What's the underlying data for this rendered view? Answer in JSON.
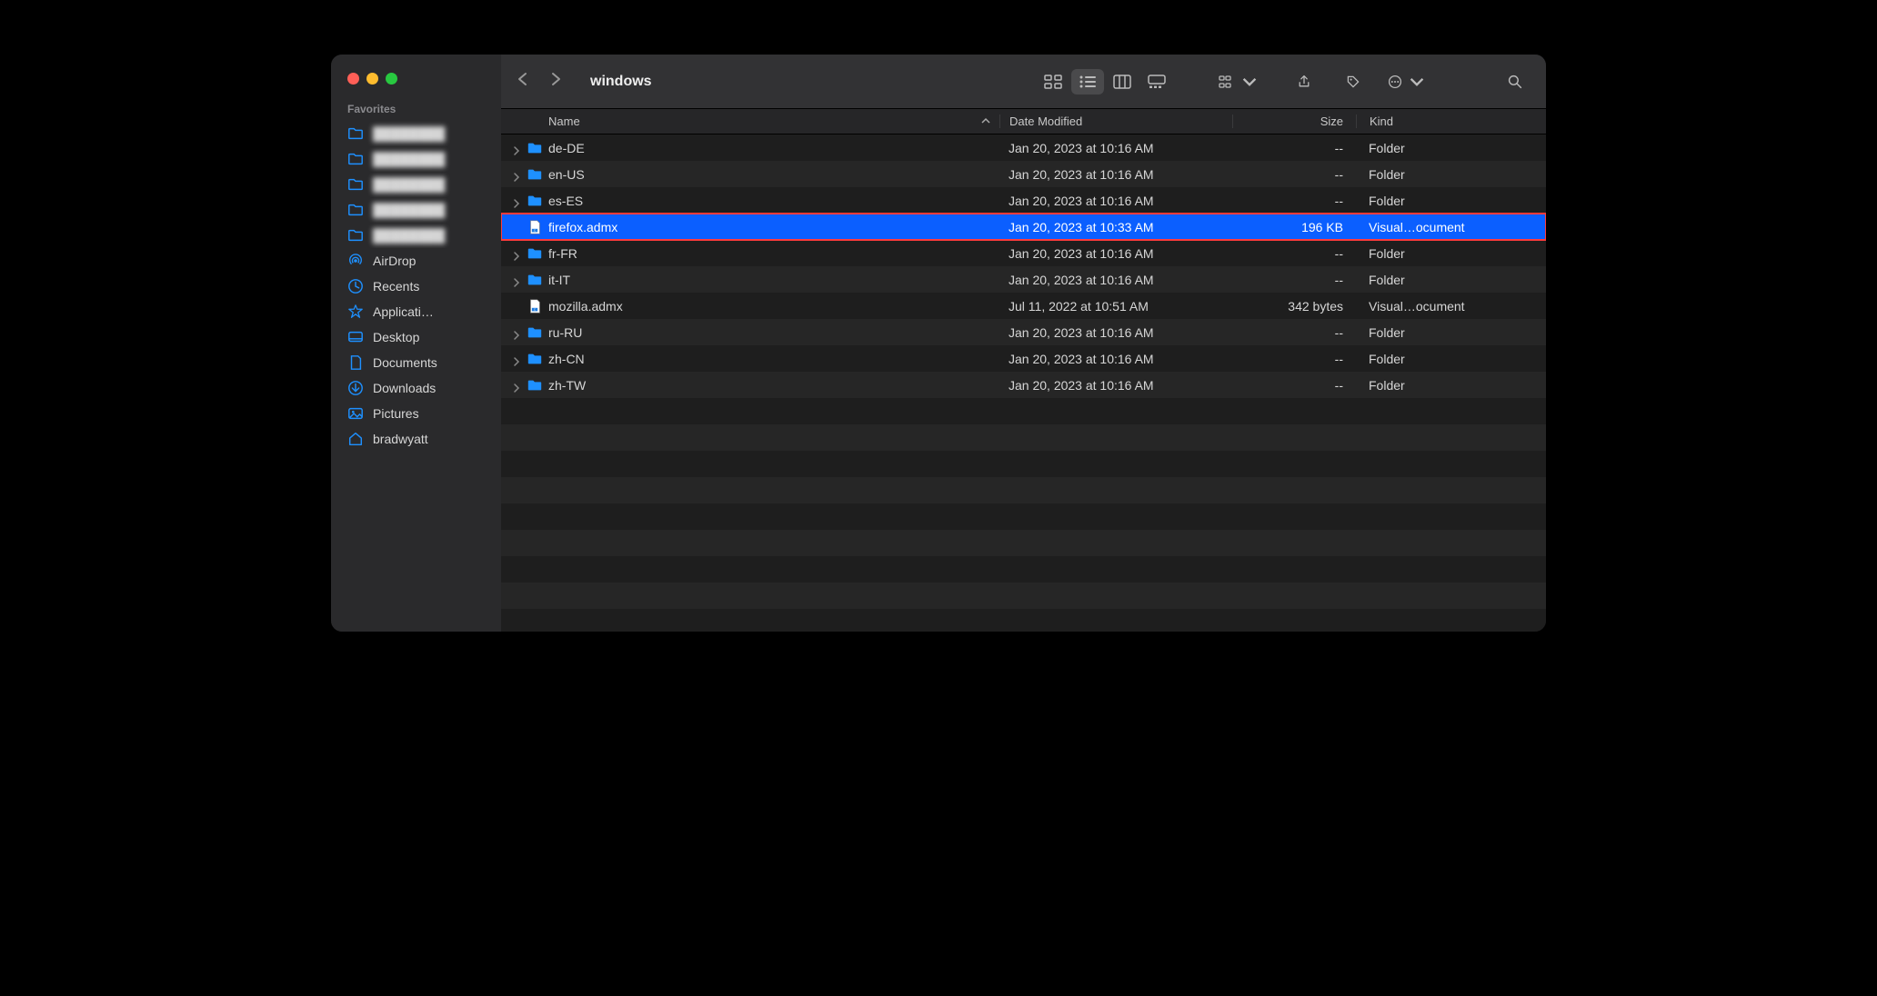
{
  "window": {
    "title": "windows"
  },
  "sidebar": {
    "header": "Favorites",
    "items": [
      {
        "icon": "folder",
        "label": "████████",
        "blurred": true
      },
      {
        "icon": "folder",
        "label": "████████",
        "blurred": true
      },
      {
        "icon": "folder",
        "label": "████████",
        "blurred": true
      },
      {
        "icon": "folder",
        "label": "████████",
        "blurred": true
      },
      {
        "icon": "folder",
        "label": "████████",
        "blurred": true
      },
      {
        "icon": "airdrop",
        "label": "AirDrop",
        "blurred": false
      },
      {
        "icon": "recents",
        "label": "Recents",
        "blurred": false
      },
      {
        "icon": "apps",
        "label": "Applicati…",
        "blurred": false
      },
      {
        "icon": "desktop",
        "label": "Desktop",
        "blurred": false
      },
      {
        "icon": "documents",
        "label": "Documents",
        "blurred": false
      },
      {
        "icon": "downloads",
        "label": "Downloads",
        "blurred": false
      },
      {
        "icon": "pictures",
        "label": "Pictures",
        "blurred": false
      },
      {
        "icon": "home",
        "label": "bradwyatt",
        "blurred": false
      }
    ]
  },
  "columns": {
    "name": "Name",
    "date": "Date Modified",
    "size": "Size",
    "kind": "Kind"
  },
  "files": [
    {
      "type": "folder",
      "name": "de-DE",
      "date": "Jan 20, 2023 at 10:16 AM",
      "size": "--",
      "kind": "Folder",
      "selected": false
    },
    {
      "type": "folder",
      "name": "en-US",
      "date": "Jan 20, 2023 at 10:16 AM",
      "size": "--",
      "kind": "Folder",
      "selected": false
    },
    {
      "type": "folder",
      "name": "es-ES",
      "date": "Jan 20, 2023 at 10:16 AM",
      "size": "--",
      "kind": "Folder",
      "selected": false
    },
    {
      "type": "file",
      "name": "firefox.admx",
      "date": "Jan 20, 2023 at 10:33 AM",
      "size": "196 KB",
      "kind": "Visual…ocument",
      "selected": true
    },
    {
      "type": "folder",
      "name": "fr-FR",
      "date": "Jan 20, 2023 at 10:16 AM",
      "size": "--",
      "kind": "Folder",
      "selected": false
    },
    {
      "type": "folder",
      "name": "it-IT",
      "date": "Jan 20, 2023 at 10:16 AM",
      "size": "--",
      "kind": "Folder",
      "selected": false
    },
    {
      "type": "file",
      "name": "mozilla.admx",
      "date": "Jul 11, 2022 at 10:51 AM",
      "size": "342 bytes",
      "kind": "Visual…ocument",
      "selected": false
    },
    {
      "type": "folder",
      "name": "ru-RU",
      "date": "Jan 20, 2023 at 10:16 AM",
      "size": "--",
      "kind": "Folder",
      "selected": false
    },
    {
      "type": "folder",
      "name": "zh-CN",
      "date": "Jan 20, 2023 at 10:16 AM",
      "size": "--",
      "kind": "Folder",
      "selected": false
    },
    {
      "type": "folder",
      "name": "zh-TW",
      "date": "Jan 20, 2023 at 10:16 AM",
      "size": "--",
      "kind": "Folder",
      "selected": false
    }
  ]
}
